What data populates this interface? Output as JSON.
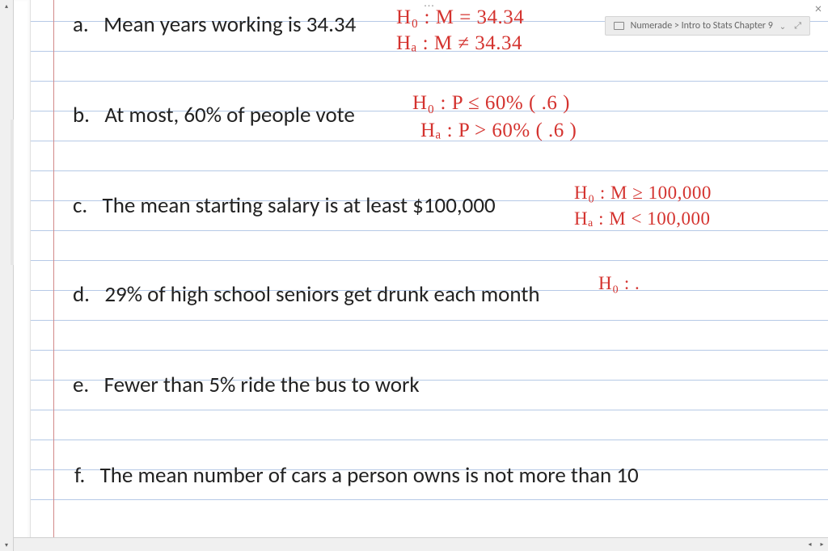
{
  "window": {
    "breadcrumb": "Numerade > Intro to Stats Chapter 9",
    "ellipsis": "..."
  },
  "items": {
    "a": {
      "label": "a.",
      "text": "Mean years working is 34.34",
      "h0": "H₀ : M = 34.34",
      "ha": "Hₐ : M ≠ 34.34"
    },
    "b": {
      "label": "b.",
      "text": "At most, 60% of people vote",
      "h0": "H₀ : P ≤ 60% ( .6 )",
      "ha": "Hₐ : P > 60% ( .6 )"
    },
    "c": {
      "label": "c.",
      "text": "The mean starting salary is at least $100,000",
      "h0": "H₀ : M ≥ 100,000",
      "ha": "Hₐ : M < 100,000"
    },
    "d": {
      "label": "d.",
      "text": "29% of high school seniors get drunk each month",
      "h0": "H₀ : ."
    },
    "e": {
      "label": "e.",
      "text": "Fewer than 5% ride the bus to work"
    },
    "f": {
      "label": "f.",
      "text": "The mean number of cars a person owns is not more than 10"
    }
  }
}
